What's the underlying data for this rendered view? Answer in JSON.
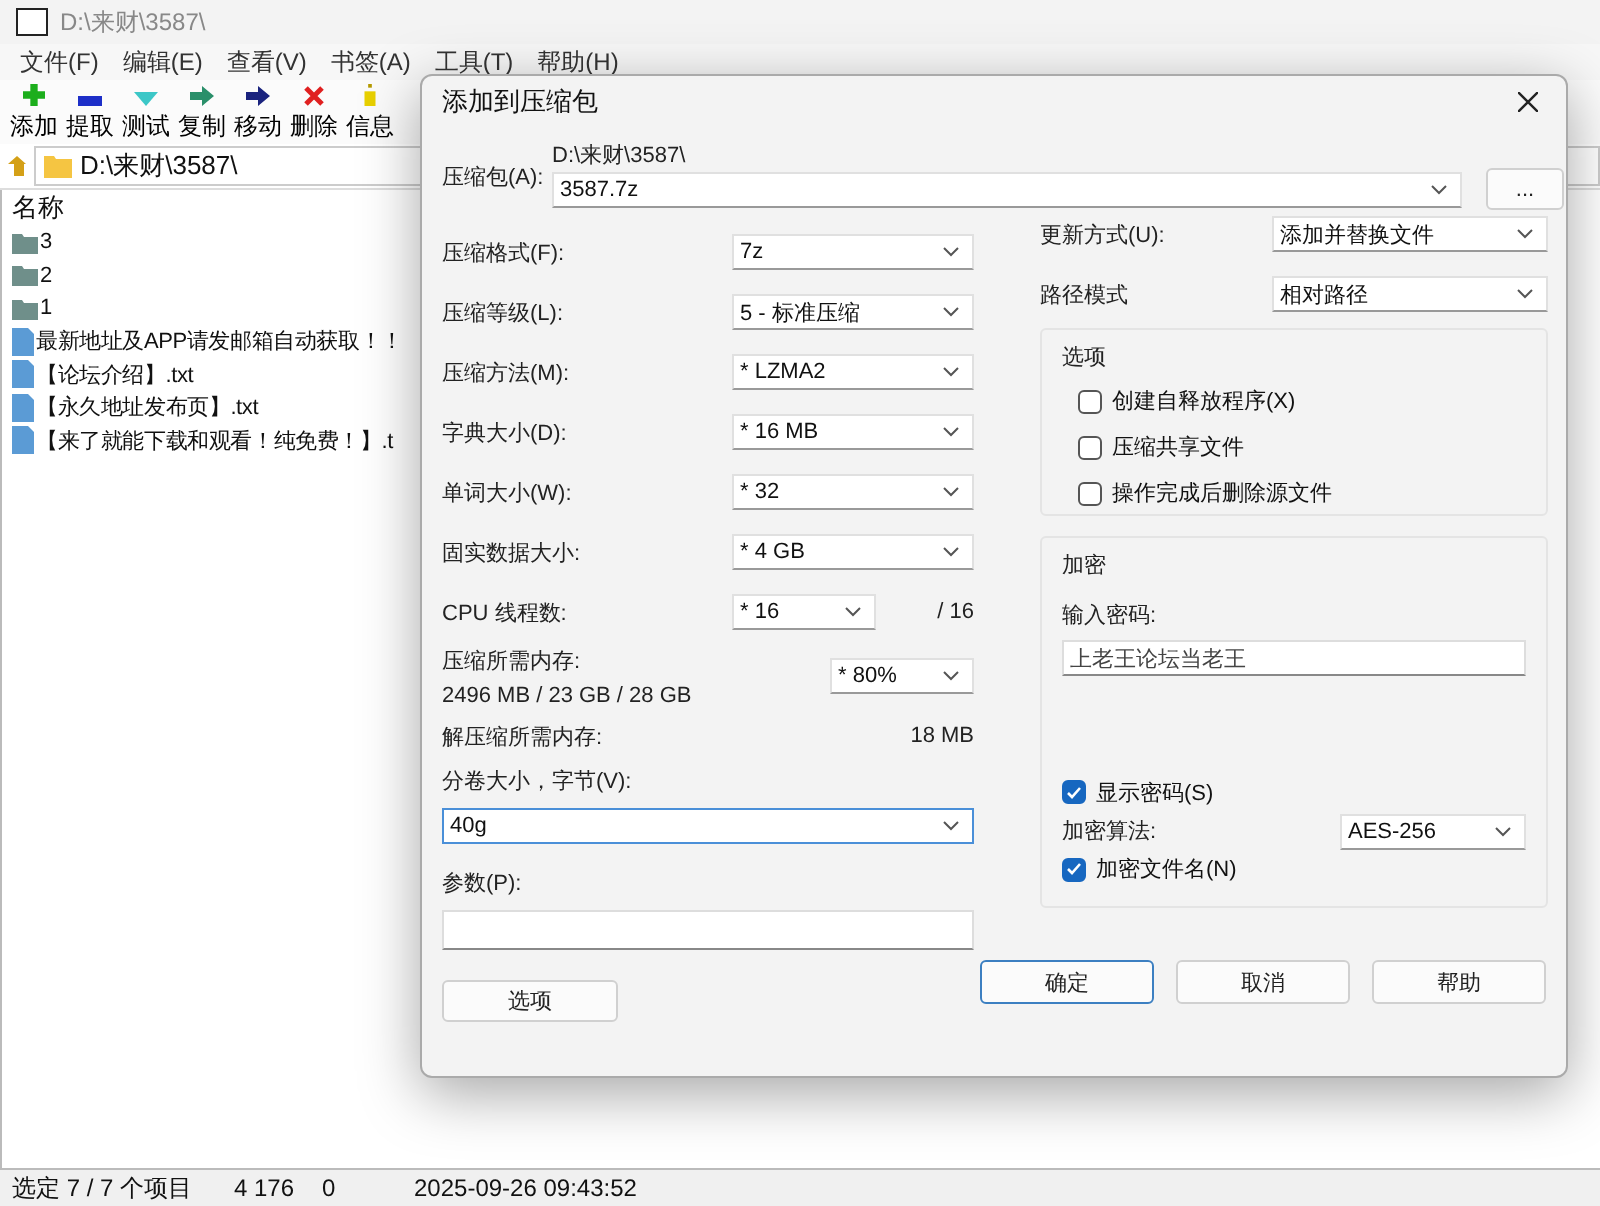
{
  "window": {
    "title": "D:\\来财\\3587\\",
    "menu": [
      "文件(F)",
      "编辑(E)",
      "查看(V)",
      "书签(A)",
      "工具(T)",
      "帮助(H)"
    ],
    "toolbar": [
      {
        "label": "添加",
        "kind": "add"
      },
      {
        "label": "提取",
        "kind": "extract"
      },
      {
        "label": "测试",
        "kind": "test"
      },
      {
        "label": "复制",
        "kind": "copy"
      },
      {
        "label": "移动",
        "kind": "move"
      },
      {
        "label": "删除",
        "kind": "delete"
      },
      {
        "label": "信息",
        "kind": "info"
      }
    ],
    "path": "D:\\来财\\3587\\",
    "file_list": {
      "column": "名称",
      "items": [
        {
          "name": "3",
          "kind": "folder"
        },
        {
          "name": "2",
          "kind": "folder"
        },
        {
          "name": "1",
          "kind": "folder"
        },
        {
          "name": "最新地址及APP请发邮箱自动获取！！",
          "kind": "file"
        },
        {
          "name": "【论坛介绍】.txt",
          "kind": "file"
        },
        {
          "name": "【永久地址发布页】.txt",
          "kind": "file"
        },
        {
          "name": "【来了就能下载和观看！纯免费！】.t",
          "kind": "file"
        }
      ]
    },
    "status_bar": [
      "选定 7 / 7 个项目",
      "4 176",
      "0",
      "2025-09-26 09:43:52"
    ]
  },
  "dialog": {
    "title": "添加到压缩包",
    "archive": {
      "label": "压缩包(A):",
      "folder": "D:\\来财\\3587\\",
      "value": "3587.7z",
      "browse": "..."
    },
    "settings": [
      {
        "label": "压缩格式(F):",
        "value": "7z"
      },
      {
        "label": "压缩等级(L):",
        "value": "5 - 标准压缩"
      },
      {
        "label": "压缩方法(M):",
        "value": "*  LZMA2"
      },
      {
        "label": "字典大小(D):",
        "value": "*  16 MB"
      },
      {
        "label": "单词大小(W):",
        "value": "*  32"
      },
      {
        "label": "固实数据大小:",
        "value": "*  4 GB"
      }
    ],
    "cpu": {
      "label": "CPU 线程数:",
      "value": "*  16",
      "total": "/ 16"
    },
    "memory": {
      "label": "压缩所需内存:",
      "usage": "2496 MB / 23 GB / 28 GB",
      "value": "* 80%"
    },
    "decompress_memory": {
      "label": "解压缩所需内存:",
      "value": "18 MB"
    },
    "volume": {
      "label": "分卷大小，字节(V):",
      "value": "40g",
      "focused": true
    },
    "parameters": {
      "label": "参数(P):"
    },
    "options_button": "选项",
    "update": {
      "label": "更新方式(U):",
      "value": "添加并替换文件"
    },
    "path_mode": {
      "label": "路径模式",
      "value": "相对路径"
    },
    "options_group": {
      "title": "选项",
      "checkboxes": [
        {
          "label": "创建自释放程序(X)",
          "checked": false
        },
        {
          "label": "压缩共享文件",
          "checked": false
        },
        {
          "label": "操作完成后删除源文件",
          "checked": false
        }
      ]
    },
    "encryption": {
      "title": "加密",
      "password_label": "输入密码:",
      "password": "上老王论坛当老王",
      "show_password": {
        "label": "显示密码(S)",
        "checked": true
      },
      "method": {
        "label": "加密算法:",
        "value": "AES-256"
      },
      "encrypt_names": {
        "label": "加密文件名(N)",
        "checked": true
      }
    },
    "buttons": [
      {
        "label": "确定",
        "default": true
      },
      {
        "label": "取消",
        "default": false
      },
      {
        "label": "帮助",
        "default": false
      }
    ]
  }
}
